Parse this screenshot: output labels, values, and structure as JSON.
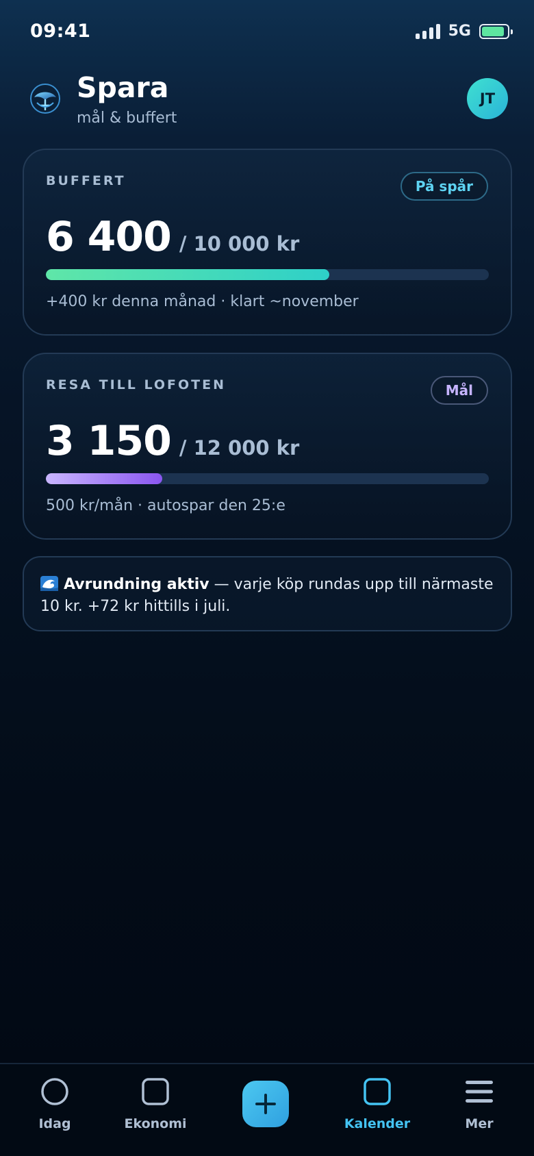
{
  "status_bar": {
    "time": "09:41",
    "network": "5G",
    "battery_level": 0.9,
    "signal_bars": 4
  },
  "header": {
    "title": "Spara",
    "subtitle": "mål & buffert",
    "avatar_initials": "JT",
    "logo_icon": "whale-emblem-icon"
  },
  "cards": [
    {
      "label": "BUFFERT",
      "badge": "På spår",
      "amount": "6 400",
      "target": "/ 10 000 kr",
      "progress": 0.64,
      "note": "+400 kr denna månad · klart ~november",
      "accent": "#2ed0c8"
    },
    {
      "label": "RESA TILL LOFOTEN",
      "badge": "Mål",
      "amount": "3 150",
      "target": "/ 12 000 kr",
      "progress": 0.2625,
      "note": "500 kr/mån · autospar den 25:e",
      "accent": "#8a56f0"
    }
  ],
  "info": {
    "icon": "wave-icon",
    "bold": "Avrundning aktiv",
    "text": " — varje köp rundas upp till närmaste 10 kr. +72 kr hittills i juli."
  },
  "tabbar": {
    "items": [
      {
        "label": "Idag",
        "icon": "circle-icon",
        "active": false
      },
      {
        "label": "Ekonomi",
        "icon": "square-icon",
        "active": false
      },
      {
        "label": "",
        "icon": "plus-icon",
        "active": false
      },
      {
        "label": "Kalender",
        "icon": "square-icon",
        "active": true
      },
      {
        "label": "Mer",
        "icon": "menu-icon",
        "active": false
      }
    ],
    "active_color": "#44c3f2"
  }
}
